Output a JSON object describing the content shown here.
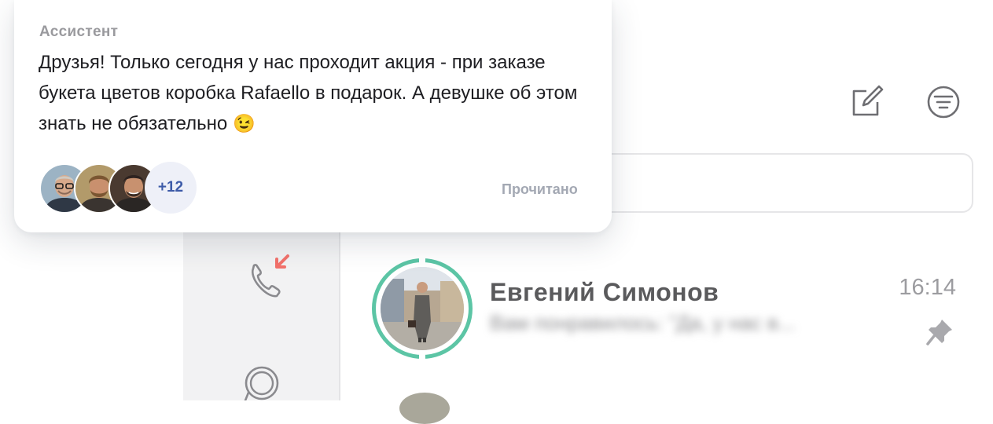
{
  "popup": {
    "sender": "Ассистент",
    "message": "Друзья! Только сегодня у нас проходит акция - при заказе букета цветов коробка Rafaello в подарок. А девушке об этом знать не обязательно",
    "emoji": "😉",
    "readers_more": "+12",
    "status": "Прочитано"
  },
  "chat_list": [
    {
      "name": "Евгений Симонов",
      "preview": "Вам понравилось: \"Да, у нас в...",
      "time": "16:14",
      "pinned": true
    }
  ],
  "colors": {
    "accent_ring": "#5cc5a5",
    "missed_call": "#f2716b",
    "read_status": "#a3a8b3"
  },
  "icons": [
    "phone-incoming-icon",
    "chat-bubble-icon",
    "compose-icon",
    "filter-icon",
    "pin-icon"
  ]
}
